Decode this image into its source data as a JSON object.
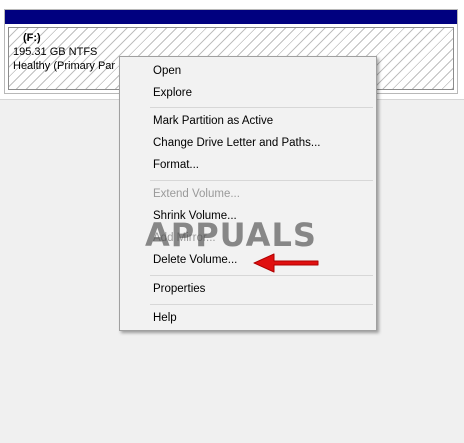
{
  "volume": {
    "letter": "(F:)",
    "size_fs": "195.31 GB NTFS",
    "status": "Healthy (Primary Par"
  },
  "context_menu": {
    "items": [
      {
        "label": "Open",
        "enabled": true
      },
      {
        "label": "Explore",
        "enabled": true
      },
      {
        "label": "Mark Partition as Active",
        "enabled": true
      },
      {
        "label": "Change Drive Letter and Paths...",
        "enabled": true
      },
      {
        "label": "Format...",
        "enabled": true
      },
      {
        "label": "Extend Volume...",
        "enabled": false
      },
      {
        "label": "Shrink Volume...",
        "enabled": true
      },
      {
        "label": "Add Mirror...",
        "enabled": false
      },
      {
        "label": "Delete Volume...",
        "enabled": true
      },
      {
        "label": "Properties",
        "enabled": true
      },
      {
        "label": "Help",
        "enabled": true
      }
    ]
  },
  "watermark": {
    "text": "APPUALS"
  },
  "colors": {
    "volume_header": "#00007f",
    "menu_background": "#f2f2f2",
    "disabled_text": "#9a9a9a",
    "annotation_arrow": "#e01010"
  },
  "icons": {
    "annotation": "red-arrow-left-icon",
    "watermark_mascot": "appuals-mascot-icon"
  }
}
